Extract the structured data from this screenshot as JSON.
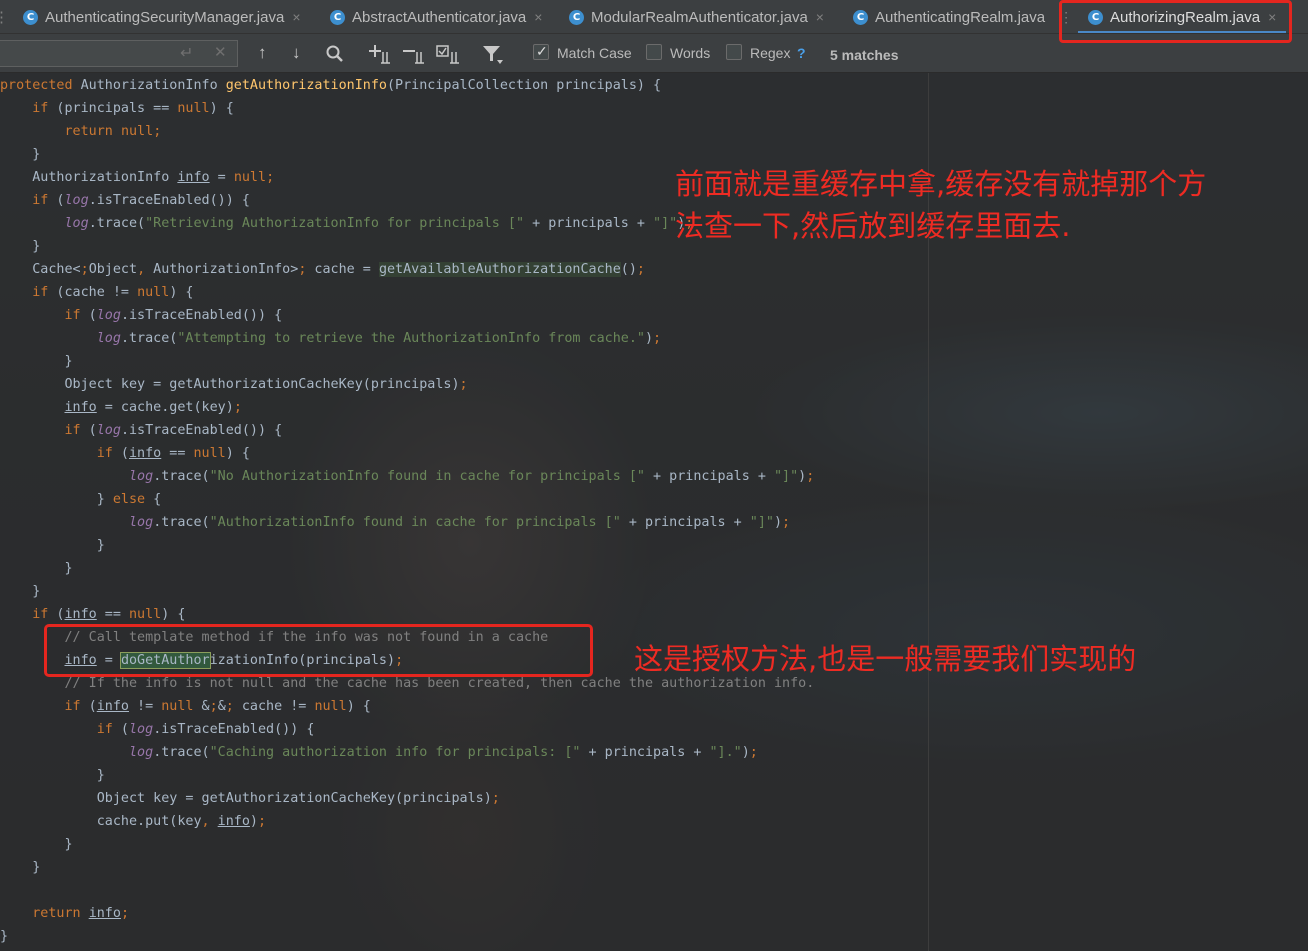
{
  "tabs": [
    {
      "label": "AuthenticatingSecurityManager.java",
      "icon": "class-icon",
      "active": false
    },
    {
      "label": "AbstractAuthenticator.java",
      "icon": "class-icon",
      "active": false
    },
    {
      "label": "ModularRealmAuthenticator.java",
      "icon": "class-icon",
      "active": false
    },
    {
      "label": "AuthenticatingRealm.java",
      "icon": "class-icon",
      "active": false
    },
    {
      "label": "AuthorizingRealm.java",
      "icon": "class-icon",
      "active": true
    }
  ],
  "icon_glyphs": {
    "class": "C",
    "close": "×",
    "overflow": "⋮"
  },
  "findbar": {
    "search_value": "",
    "match_case_label": "Match Case",
    "match_case_checked": true,
    "words_label": "Words",
    "words_checked": false,
    "regex_label": "Regex",
    "regex_checked": false,
    "regex_help": "?",
    "matches": "5 matches",
    "icons": [
      "prev-occurrence-icon",
      "next-occurrence-icon",
      "find-all-icon",
      "add-occurrence-icon",
      "remove-occurrence-icon",
      "select-all-occurrences-icon",
      "filter-icon"
    ]
  },
  "code_lines": [
    "protected AuthorizationInfo getAuthorizationInfo(PrincipalCollection principals) {",
    "    if (principals == null) {",
    "        return null;",
    "    }",
    "    AuthorizationInfo info = null;",
    "    if (log.isTraceEnabled()) {",
    "        log.trace(\"Retrieving AuthorizationInfo for principals [\" + principals + \"]\");",
    "    }",
    "    Cache<Object, AuthorizationInfo> cache = getAvailableAuthorizationCache();",
    "    if (cache != null) {",
    "        if (log.isTraceEnabled()) {",
    "            log.trace(\"Attempting to retrieve the AuthorizationInfo from cache.\");",
    "        }",
    "        Object key = getAuthorizationCacheKey(principals);",
    "        info = cache.get(key);",
    "        if (log.isTraceEnabled()) {",
    "            if (info == null) {",
    "                log.trace(\"No AuthorizationInfo found in cache for principals [\" + principals + \"]\");",
    "            } else {",
    "                log.trace(\"AuthorizationInfo found in cache for principals [\" + principals + \"]\");",
    "            }",
    "        }",
    "    }",
    "    if (info == null) {",
    "        // Call template method if the info was not found in a cache",
    "        info = doGetAuthorizationInfo(principals);",
    "        // If the info is not null and the cache has been created, then cache the authorization info.",
    "        if (info != null && cache != null) {",
    "            if (log.isTraceEnabled()) {",
    "                log.trace(\"Caching authorization info for principals: [\" + principals + \"].\");",
    "            }",
    "            Object key = getAuthorizationCacheKey(principals);",
    "            cache.put(key, info);",
    "        }",
    "    }",
    "",
    "    return info;",
    "}"
  ],
  "annotations": {
    "note1_line1": "前面就是重缓存中拿,缓存没有就掉那个方",
    "note1_line2": "法查一下,然后放到缓存里面去.",
    "note2": "这是授权方法,也是一般需要我们实现的"
  },
  "colors": {
    "keyword": "#cc7832",
    "method_decl": "#ffc66d",
    "string": "#6a8759",
    "comment": "#808080",
    "field": "#9876aa",
    "annotation_red": "#ee2b23",
    "tab_underline": "#4a88c7"
  }
}
